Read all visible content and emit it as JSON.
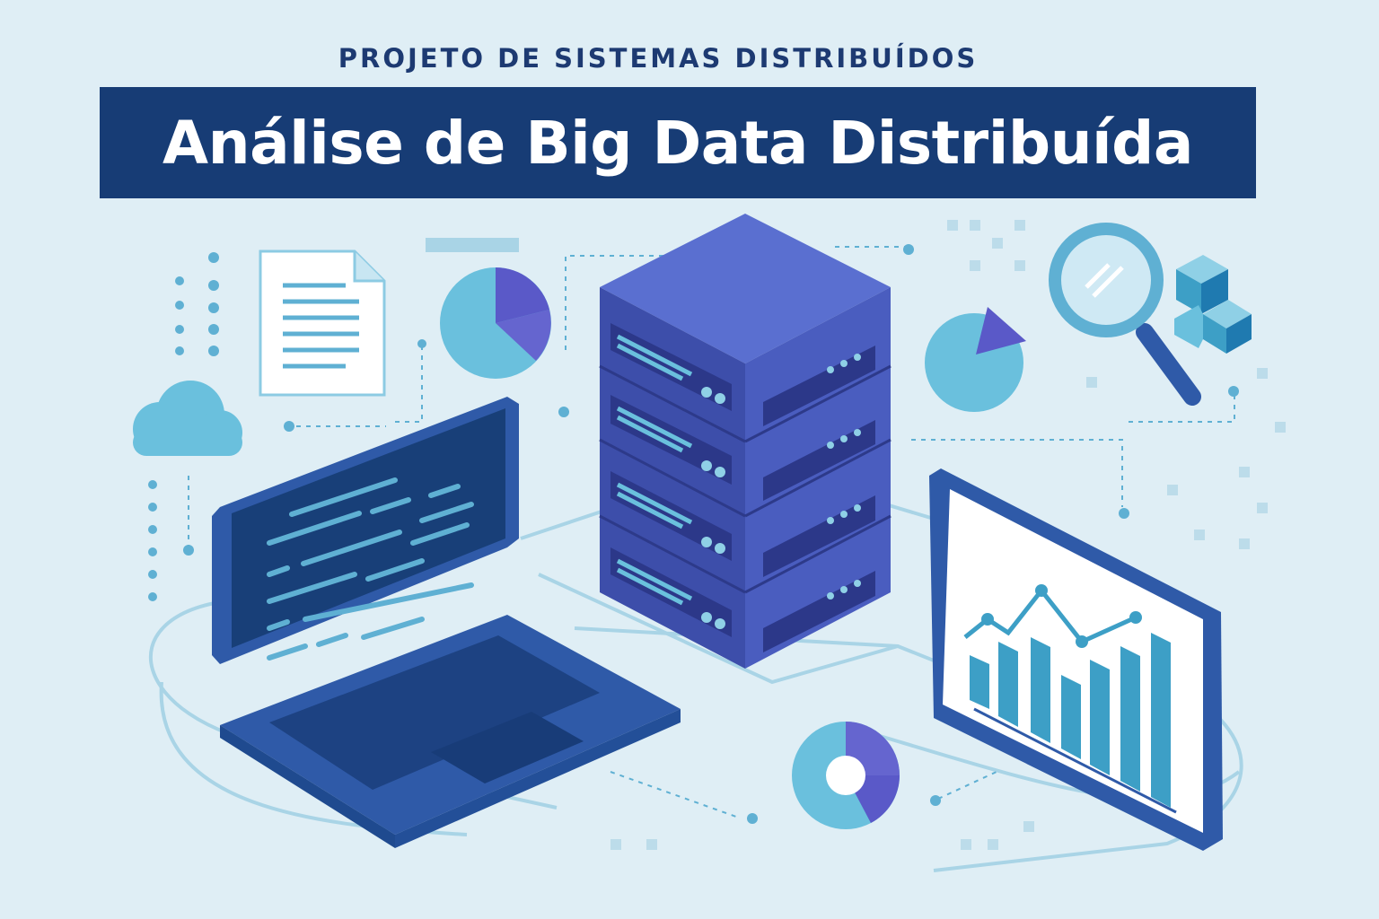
{
  "header": {
    "subtitle": "PROJETO DE SISTEMAS DISTRIBUÍDOS",
    "title": "Análise de Big Data Distribuída"
  },
  "colors": {
    "background": "#dfeef5",
    "title_bar": "#173c75",
    "title_text": "#ffffff",
    "subtitle_text": "#1d3a72",
    "server": "#4a5dbf",
    "accent_light": "#6ac0dd",
    "accent_mid": "#3d9fc6",
    "laptop": "#2f5aa8"
  },
  "icons": [
    "document-icon",
    "pie-chart-icon",
    "cloud-icon",
    "laptop-icon",
    "server-rack-icon",
    "magnifier-icon",
    "cubes-icon",
    "monitor-bar-chart-icon",
    "donut-chart-icon"
  ]
}
